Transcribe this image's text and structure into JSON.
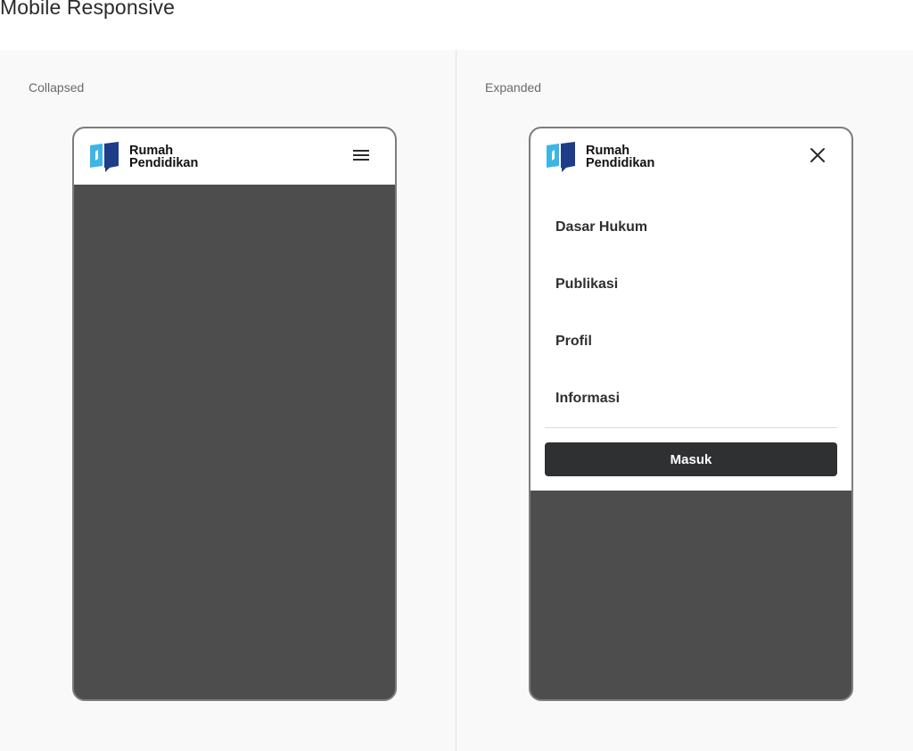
{
  "page_title": "Mobile Responsive",
  "collapsed": {
    "label": "Collapsed",
    "logo": {
      "line1": "Rumah",
      "line2": "Pendidikan"
    },
    "menu_icon": "hamburger-menu-icon"
  },
  "expanded": {
    "label": "Expanded",
    "logo": {
      "line1": "Rumah",
      "line2": "Pendidikan"
    },
    "close_icon": "close-icon",
    "nav_items": [
      {
        "label": "Dasar Hukum"
      },
      {
        "label": "Publikasi"
      },
      {
        "label": "Profil"
      },
      {
        "label": "Informasi"
      }
    ],
    "login_button": "Masuk"
  },
  "colors": {
    "canvas": "#f9f9f9",
    "overlay": "#4d4d4d",
    "logo_light_blue": "#3cb6e6",
    "logo_dark_blue": "#1f3c88",
    "button": "#2f3032"
  }
}
